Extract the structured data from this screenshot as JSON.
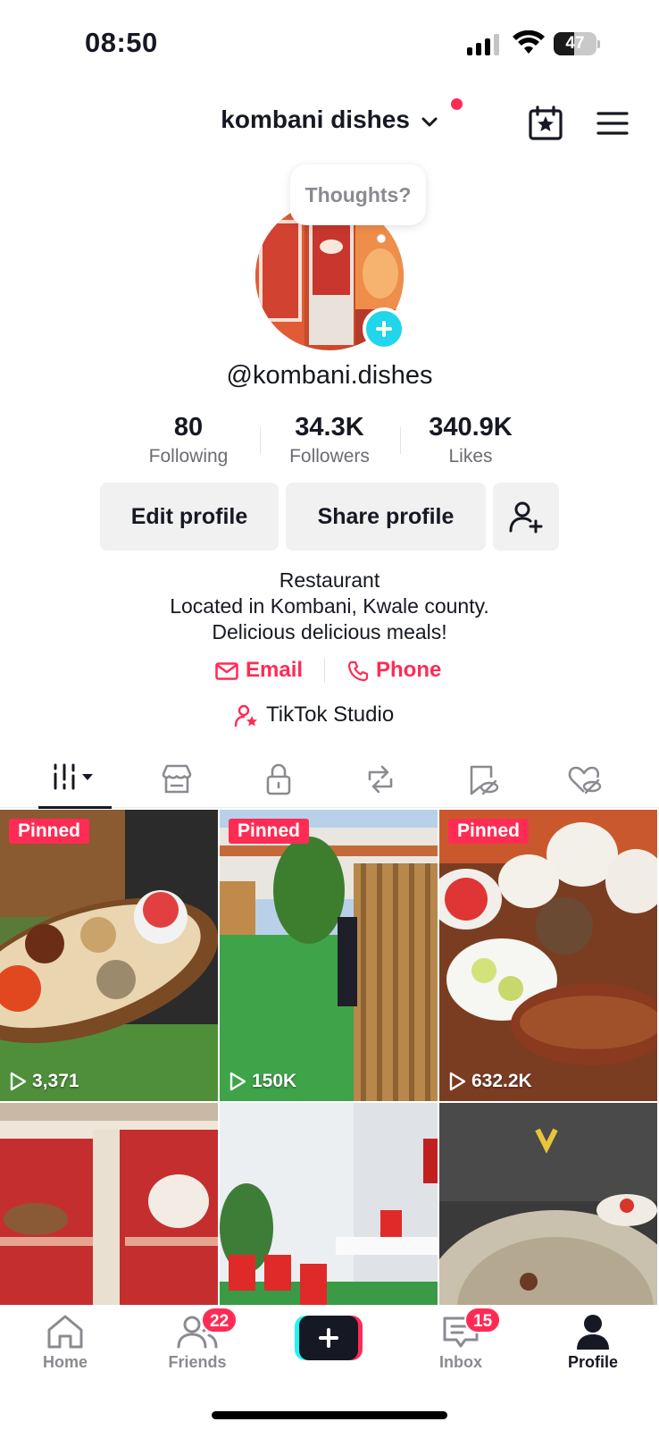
{
  "status_bar": {
    "time": "08:50",
    "battery": "47",
    "battery_level": 0.47
  },
  "header": {
    "account_name": "kombani dishes"
  },
  "avatar": {
    "thoughts_placeholder": "Thoughts?"
  },
  "profile": {
    "username": "@kombani.dishes"
  },
  "stats": [
    {
      "value": "80",
      "label": "Following"
    },
    {
      "value": "34.3K",
      "label": "Followers"
    },
    {
      "value": "340.9K",
      "label": "Likes"
    }
  ],
  "actions": {
    "edit": "Edit profile",
    "share": "Share profile"
  },
  "bio": {
    "lines": [
      "Restaurant",
      "Located in Kombani, Kwale county.",
      "Delicious delicious  meals!"
    ],
    "email": "Email",
    "phone": "Phone",
    "studio": "TikTok Studio"
  },
  "tabs": [
    "videos-icon",
    "shop-icon",
    "private-icon",
    "reposts-icon",
    "favorites-icon",
    "liked-icon"
  ],
  "videos": [
    {
      "pinned": "Pinned",
      "views": "3,371"
    },
    {
      "pinned": "Pinned",
      "views": "150K"
    },
    {
      "pinned": "Pinned",
      "views": "632.2K"
    },
    {
      "pinned": "",
      "views": ""
    },
    {
      "pinned": "",
      "views": ""
    },
    {
      "pinned": "",
      "views": ""
    }
  ],
  "bottom_nav": {
    "home": "Home",
    "friends": "Friends",
    "friends_badge": "22",
    "inbox": "Inbox",
    "inbox_badge": "15",
    "profile": "Profile"
  },
  "colors": {
    "accent": "#fe2c55",
    "cyan": "#25f4ee",
    "text": "#161823"
  }
}
